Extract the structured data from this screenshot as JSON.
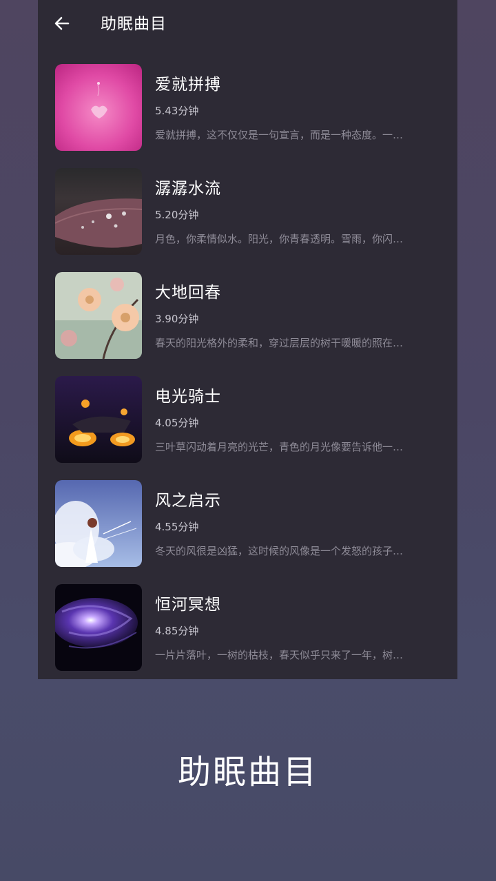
{
  "header": {
    "title": "助眠曲目",
    "back_icon": "arrow-left-icon"
  },
  "tracks": [
    {
      "name": "爱就拼搏",
      "duration": "5.43分钟",
      "description": "爱就拼搏，这不仅仅是一句宣言，而是一种态度。一…",
      "thumb": "pink-heart-art"
    },
    {
      "name": "潺潺水流",
      "duration": "5.20分钟",
      "description": "月色，你柔情似水。阳光，你青春透明。雪雨，你闪…",
      "thumb": "leaf-droplets"
    },
    {
      "name": "大地回春",
      "duration": "3.90分钟",
      "description": "春天的阳光格外的柔和，穿过层层的树干暖暖的照在…",
      "thumb": "spring-blossoms"
    },
    {
      "name": "电光骑士",
      "duration": "4.05分钟",
      "description": "三叶草闪动着月亮的光芒，青色的月光像要告诉他一…",
      "thumb": "flaming-motorcycle"
    },
    {
      "name": "风之启示",
      "duration": "4.55分钟",
      "description": "冬天的风很是凶猛，这时候的风像是一个发怒的孩子…",
      "thumb": "girl-in-clouds"
    },
    {
      "name": "恒河冥想",
      "duration": "4.85分钟",
      "description": "一片片落叶，一树的枯枝，春天似乎只来了一年，树…",
      "thumb": "galaxy-spiral"
    }
  ],
  "caption": "助眠曲目"
}
